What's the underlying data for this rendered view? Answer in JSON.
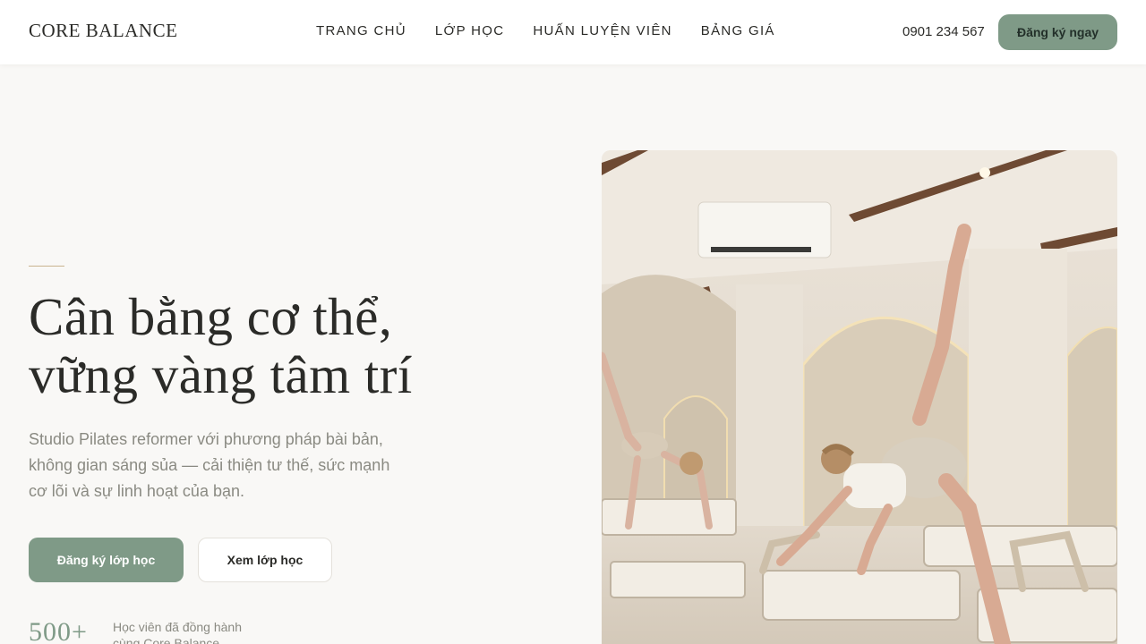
{
  "header": {
    "logo": "CORE BALANCE",
    "nav": [
      {
        "label": "TRANG CHỦ"
      },
      {
        "label": "LỚP HỌC"
      },
      {
        "label": "HUẤN LUYỆN VIÊN"
      },
      {
        "label": "BẢNG GIÁ"
      }
    ],
    "phone": "0901 234 567",
    "cta": "Đăng ký ngay"
  },
  "hero": {
    "title_line1": "Cân bằng cơ thể,",
    "title_line2": "vững vàng tâm trí",
    "lead_line1": "Studio Pilates reformer với phương pháp bài bản,",
    "lead_line2": "không gian sáng sủa — cải thiện tư thế, sức mạnh",
    "lead_line3": "cơ lõi và sự linh hoạt của bạn.",
    "primary_button": "Đăng ký lớp học",
    "secondary_button": "Xem lớp học",
    "stat": {
      "value": "500+",
      "label_line1": "Học viên đã đồng hành",
      "label_line2": "cùng Core Balance"
    }
  },
  "colors": {
    "accent": "#7f9a87",
    "background": "#f9f8f6",
    "divider": "#c9b48f"
  }
}
